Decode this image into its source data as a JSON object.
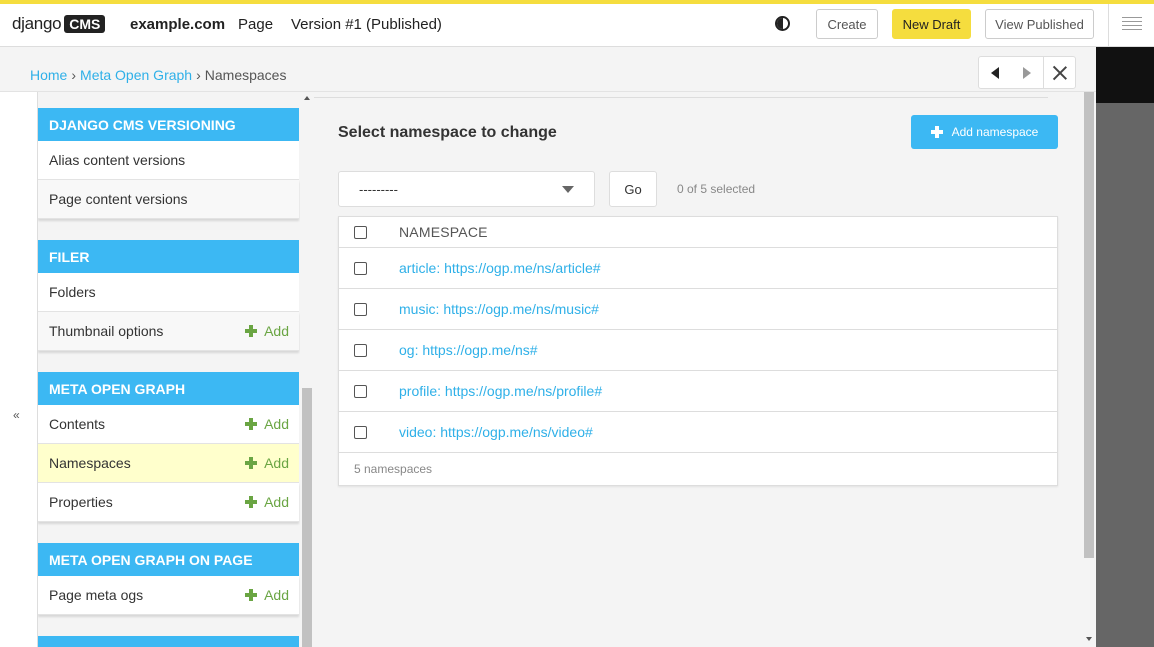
{
  "toolbar": {
    "logo_text": "django",
    "logo_badge": "CMS",
    "site": "example.com",
    "page_menu": "Page",
    "version": "Version #1 (Published)",
    "contrast_icon": "contrast-icon",
    "create_label": "Create",
    "new_draft_label": "New Draft",
    "view_published_label": "View Published",
    "menu_icon": "hamburger-menu-icon",
    "accent_color": "#f5dd3e"
  },
  "breadcrumb": {
    "home": "Home",
    "app": "Meta Open Graph",
    "current": "Namespaces",
    "separator": "›"
  },
  "sidebar": {
    "collapse_label": "«",
    "header_color": "#3cb8f3",
    "add_label": "Add",
    "modules": [
      {
        "title": "DJANGO CMS VERSIONING",
        "items": [
          {
            "label": "Alias content versions"
          },
          {
            "label": "Page content versions"
          }
        ]
      },
      {
        "title": "FILER",
        "items": [
          {
            "label": "Folders"
          },
          {
            "label": "Thumbnail options",
            "add": "Add"
          }
        ]
      },
      {
        "title": "META OPEN GRAPH",
        "items": [
          {
            "label": "Contents",
            "add": "Add"
          },
          {
            "label": "Namespaces",
            "add": "Add"
          },
          {
            "label": "Properties",
            "add": "Add"
          }
        ]
      },
      {
        "title": "META OPEN GRAPH ON PAGE",
        "items": [
          {
            "label": "Page meta ogs",
            "add": "Add"
          }
        ]
      }
    ]
  },
  "main": {
    "title": "Select namespace to change",
    "add_button": "Add namespace",
    "action_select": "---------",
    "go_button": "Go",
    "selected_count": "0 of 5 selected",
    "column_header": "NAMESPACE",
    "rows": [
      "article: https://ogp.me/ns/article#",
      "music: https://ogp.me/ns/music#",
      "og: https://ogp.me/ns#",
      "profile: https://ogp.me/ns/profile#",
      "video: https://ogp.me/ns/video#"
    ],
    "footer": "5 namespaces"
  }
}
